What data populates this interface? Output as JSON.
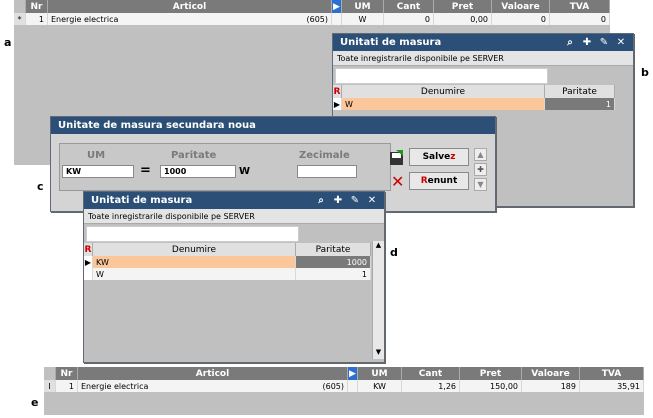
{
  "labels": {
    "a": "a",
    "b": "b",
    "c": "c",
    "d": "d",
    "e": "e"
  },
  "grid_top": {
    "columns": [
      "Nr",
      "Articol",
      "UM",
      "Cant",
      "Pret",
      "Valoare",
      "TVA"
    ],
    "row": {
      "marker": "*",
      "nr": "1",
      "articol": "Energie electrica",
      "code": "(605)",
      "um": "W",
      "cant": "0",
      "pret": "0,00",
      "valoare": "0",
      "tva": "0"
    }
  },
  "win_b": {
    "title": "Unitati de masura",
    "info": "Toate inregistrarile disponibile pe SERVER",
    "search_value": "",
    "columns": [
      "R",
      "Denumire",
      "Paritate"
    ],
    "rows": [
      {
        "denumire": "W",
        "paritate": "1"
      }
    ]
  },
  "dialog_c": {
    "title": "Unitate de masura secundara noua",
    "um_label": "UM",
    "paritate_label": "Paritate",
    "zecimale_label": "Zecimale",
    "um_value": "KW",
    "paritate_value": "1000",
    "unit_suffix": "W",
    "equals": "=",
    "save_label": "Salvez",
    "cancel_label": "Renunt"
  },
  "win_d": {
    "title": "Unitati de masura",
    "info": "Toate inregistrarile disponibile pe SERVER",
    "search_value": "",
    "columns": [
      "R",
      "Denumire",
      "Paritate"
    ],
    "rows": [
      {
        "denumire": "KW",
        "paritate": "1000"
      },
      {
        "denumire": "W",
        "paritate": "1"
      }
    ]
  },
  "grid_bottom": {
    "columns": [
      "Nr",
      "Articol",
      "UM",
      "Cant",
      "Pret",
      "Valoare",
      "TVA"
    ],
    "row": {
      "marker": "I",
      "nr": "1",
      "articol": "Energie electrica",
      "code": "(605)",
      "um": "KW",
      "cant": "1,26",
      "pret": "150,00",
      "valoare": "189",
      "tva": "35,91"
    }
  },
  "colors": {
    "titlebar": "#2c4f77",
    "header": "#7a7a7a",
    "selected_row": "#fbc69a",
    "save_accent": "#cc0000"
  }
}
